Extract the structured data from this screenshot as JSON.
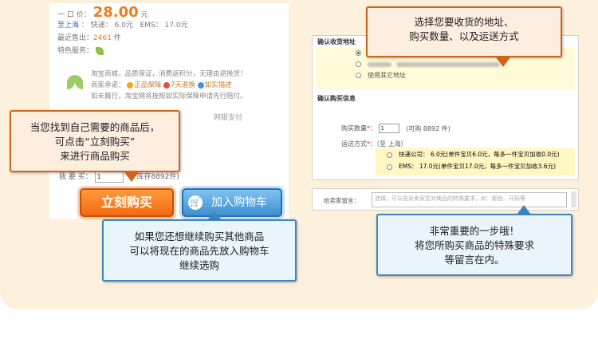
{
  "left": {
    "price_label": "一 口 价：",
    "price": "28.00",
    "price_unit": "元",
    "shipping_from": "至上海",
    "shipping_express": "快递",
    "shipping_express_price": "6.0元",
    "shipping_ems": "EMS",
    "shipping_ems_price": "17.0元",
    "sold_label": "最近售出：",
    "sold_count": "2461",
    "sold_unit": "件",
    "service_label": "特色服务：",
    "guarantee_line1": "淘宝商城，品质保证，消费返积分，无理由退换货！",
    "guarantee_promise": "商家承诺：",
    "guarantee_badge1": "正品保障",
    "guarantee_badge2": "7天退换",
    "guarantee_badge3": "如实描述",
    "guarantee_line3": "如未履行，淘宝网将按照如实际保障申请先行赔付。",
    "pay_label": "网银支付",
    "qty_label": "我 要 买：",
    "qty_value": "1",
    "stock": "库存8892件)",
    "buy_button": "立刻购买",
    "cart_button": "加入购物车"
  },
  "callouts": {
    "buy_tip": [
      "当您找到自己需要的商品后，",
      "可点击“立刻购买”",
      "来进行商品购买"
    ],
    "cart_tip": [
      "如果您还想继续购买其他商品",
      "可以将现在的商品先放入购物车",
      "继续选购"
    ],
    "address_tip": [
      "选择您要收货的地址、",
      "购买数量、以及运送方式"
    ],
    "message_tip": [
      "非常重要的一步哦！",
      "将您所购买商品的特殊要求",
      "等留言在内。"
    ]
  },
  "right": {
    "address_title": "确认收货地址",
    "use_other_address": "使用其它地址",
    "buy_info_title": "确认购买信息",
    "qty_label": "购买数量",
    "qty_value": "1",
    "qty_available": "(可购 8892 件)",
    "ship_label": "运送方式",
    "ship_dest": "（至 上海）",
    "ship_option1": "快递公司： 6.0元(单件宝贝6.0元，每多一件宝贝加收0.0元)",
    "ship_option2": "EMS： 17.0元(单件宝贝17.0元，每多一件宝贝加收3.6元)",
    "message_label": "给卖家留言：",
    "message_placeholder": "选填，可以告诉卖家您对商品的特殊要求，如：颜色、尺码等"
  },
  "colors": {
    "accent_orange": "#f07b1c",
    "accent_blue": "#3c86c4",
    "panel_bg": "#fdf1dd"
  }
}
